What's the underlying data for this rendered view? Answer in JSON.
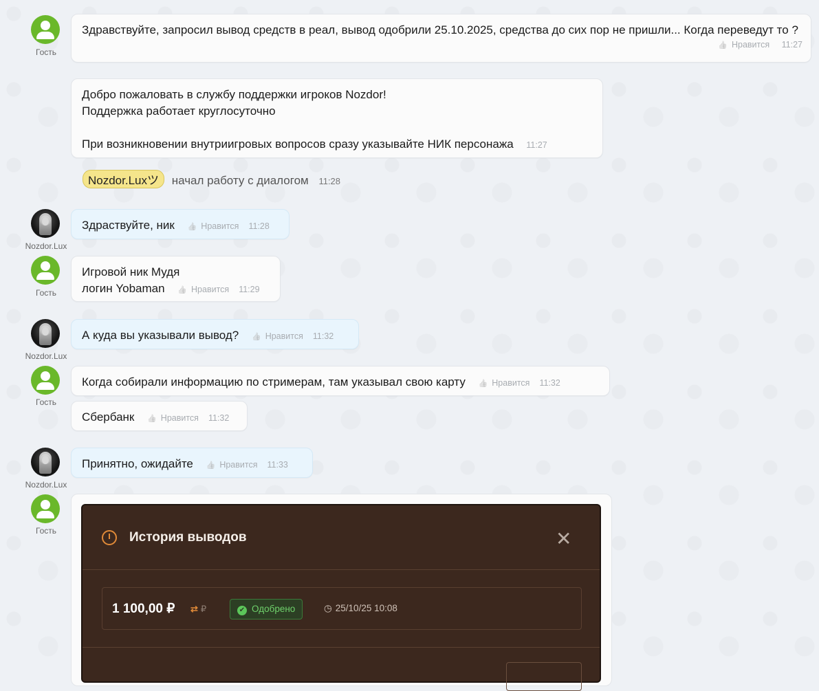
{
  "messages": [
    {
      "author": "Гость",
      "text": "Здравствуйте, запросил вывод средств в реал, вывод одобрили 25.10.2025, средства до сих пор не пришли... Когда переведут то ?",
      "like": "Нравится",
      "time": "11:27"
    },
    {
      "author": "",
      "text_lines": [
        "Добро пожаловать в службу поддержки игроков Nozdor!",
        "Поддержка работает круглосуточно",
        "",
        "При возникновении внутриигровых вопросов сразу указывайте НИК персонажа"
      ],
      "time": "11:27"
    },
    {
      "system_nick": "Nozdor.Luxツ",
      "system_text": "начал работу с диалогом",
      "time": "11:28"
    },
    {
      "author": "Nozdor.Lux",
      "text": "Здраствуйте, ник",
      "like": "Нравится",
      "time": "11:28"
    },
    {
      "author": "Гость",
      "text_lines": [
        "Игровой ник Мудя",
        "логин Yobaman"
      ],
      "like": "Нравится",
      "time": "11:29"
    },
    {
      "author": "Nozdor.Lux",
      "text": "А куда вы указывали вывод?",
      "like": "Нравится",
      "time": "11:32"
    },
    {
      "author": "Гость",
      "text": "Когда собирали информацию по стримерам, там указывал свою карту",
      "like": "Нравится",
      "time": "11:32"
    },
    {
      "author": "",
      "text": "Сбербанк",
      "like": "Нравится",
      "time": "11:32"
    },
    {
      "author": "Nozdor.Lux",
      "text": "Принятно, ожидайте",
      "like": "Нравится",
      "time": "11:33"
    },
    {
      "author": "Гость"
    }
  ],
  "screenshot": {
    "title": "История выводов",
    "amount": "1 100,00 ₽",
    "currency_swap": "⇄",
    "currency_sym": "₽",
    "status": "Одобрено",
    "date": "25/10/25 10:08",
    "close": "✕"
  },
  "colors": {
    "guest_avatar": "#6ab82a",
    "operator_bubble": "#e9f5fd",
    "approved": "#6fd16b",
    "accent": "#e08a38"
  }
}
